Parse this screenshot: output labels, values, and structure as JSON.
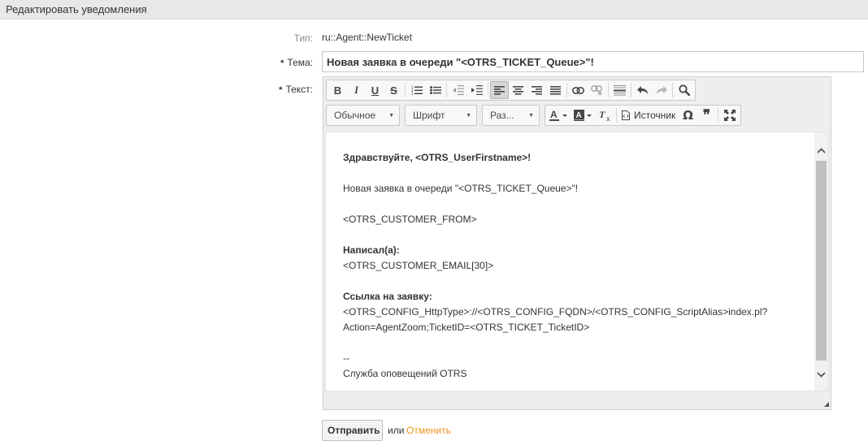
{
  "header": {
    "title": "Редактировать уведомления"
  },
  "form": {
    "type_label": "Тип:",
    "type_value": "ru::Agent::NewTicket",
    "required_mark": "*",
    "subject_label": "Тема:",
    "subject_value": "Новая заявка в очереди \"<OTRS_TICKET_Queue>\"!",
    "text_label": "Текст:"
  },
  "toolbar": {
    "row1": [
      "bold-icon",
      "italic-icon",
      "underline-icon",
      "strikethrough-icon",
      "numbered-list-icon",
      "bulleted-list-icon",
      "outdent-icon",
      "indent-icon",
      "align-left-icon",
      "align-center-icon",
      "align-right-icon",
      "justify-icon",
      "link-icon",
      "unlink-icon",
      "horizontal-line-icon",
      "undo-icon",
      "redo-icon",
      "find-icon"
    ],
    "format_label": "Обычное",
    "font_label": "Шрифт",
    "size_label": "Раз...",
    "source_label": "Источник",
    "colors": {
      "active_button": "#d6d6d6",
      "toolbar_bg": "#f8f8f8"
    }
  },
  "body": {
    "greeting": "Здравствуйте, <OTRS_UserFirstname>!",
    "line1": "Новая заявка в очереди \"<OTRS_TICKET_Queue>\"!",
    "line2": "<OTRS_CUSTOMER_FROM>",
    "wrote_label": "Написал(а):",
    "wrote_value": "<OTRS_CUSTOMER_EMAIL[30]>",
    "link_label": "Ссылка на заявку:",
    "link_line1": "<OTRS_CONFIG_HttpType>://<OTRS_CONFIG_FQDN>/<OTRS_CONFIG_ScriptAlias>index.pl?",
    "link_line2": "Action=AgentZoom;TicketID=<OTRS_TICKET_TicketID>",
    "sig_sep": "--",
    "signature": "Служба оповещений OTRS"
  },
  "actions": {
    "submit_label": "Отправить",
    "or_label": "или",
    "cancel_label": "Отменить",
    "cancel_color": "#f0921f"
  }
}
